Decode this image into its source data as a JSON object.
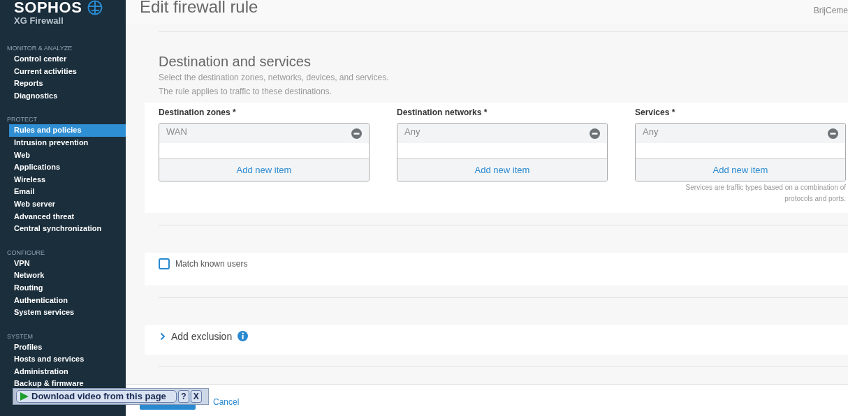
{
  "brand": {
    "logo": "SOPHOS",
    "product": "XG Firewall"
  },
  "page_title": "Edit firewall rule",
  "user": "BrijCeme",
  "sidebar": {
    "sections": [
      {
        "heading": "MONITOR & ANALYZE",
        "items": [
          {
            "label": "Control center",
            "selected": false
          },
          {
            "label": "Current activities",
            "selected": false
          },
          {
            "label": "Reports",
            "selected": false
          },
          {
            "label": "Diagnostics",
            "selected": false
          }
        ]
      },
      {
        "heading": "PROTECT",
        "items": [
          {
            "label": "Rules and policies",
            "selected": true
          },
          {
            "label": "Intrusion prevention",
            "selected": false
          },
          {
            "label": "Web",
            "selected": false
          },
          {
            "label": "Applications",
            "selected": false
          },
          {
            "label": "Wireless",
            "selected": false
          },
          {
            "label": "Email",
            "selected": false
          },
          {
            "label": "Web server",
            "selected": false
          },
          {
            "label": "Advanced threat",
            "selected": false
          },
          {
            "label": "Central synchronization",
            "selected": false
          }
        ]
      },
      {
        "heading": "CONFIGURE",
        "items": [
          {
            "label": "VPN",
            "selected": false
          },
          {
            "label": "Network",
            "selected": false
          },
          {
            "label": "Routing",
            "selected": false
          },
          {
            "label": "Authentication",
            "selected": false
          },
          {
            "label": "System services",
            "selected": false
          }
        ]
      },
      {
        "heading": "SYSTEM",
        "items": [
          {
            "label": "Profiles",
            "selected": false
          },
          {
            "label": "Hosts and services",
            "selected": false
          },
          {
            "label": "Administration",
            "selected": false
          },
          {
            "label": "Backup & firmware",
            "selected": false
          }
        ]
      }
    ]
  },
  "destination": {
    "title": "Destination and services",
    "description": [
      "Select the destination zones, networks, devices, and services.",
      "The rule applies to traffic to these destinations."
    ],
    "fields": [
      {
        "label": "Destination zones *",
        "value": "WAN",
        "action": "Add new item"
      },
      {
        "label": "Destination networks *",
        "value": "Any",
        "action": "Add new item"
      },
      {
        "label": "Services *",
        "value": "Any",
        "action": "Add new item",
        "note": "Services are traffic types based on a combination of protocols and ports."
      }
    ]
  },
  "match_known_users": {
    "label": "Match known users",
    "checked": false
  },
  "exclusion": {
    "label": "Add exclusion",
    "expanded": false
  },
  "footer": {
    "cancel": "Cancel"
  },
  "download_bar": {
    "label": "Download video from this page",
    "help": "?",
    "close": "X"
  }
}
